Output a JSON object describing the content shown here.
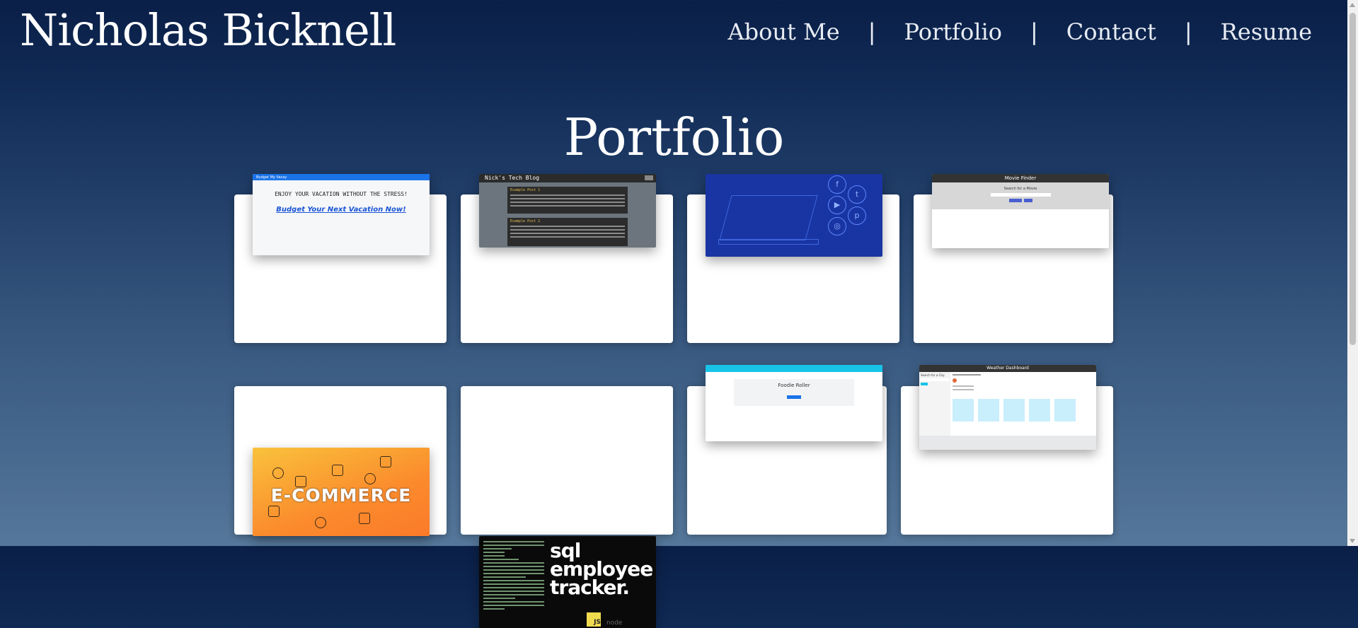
{
  "header": {
    "site_title": "Nicholas Bicknell",
    "nav": [
      {
        "label": "About Me"
      },
      {
        "label": "Portfolio"
      },
      {
        "label": "Contact"
      },
      {
        "label": "Resume"
      }
    ],
    "separator": "|"
  },
  "main": {
    "heading": "Portfolio",
    "projects": [
      {
        "id": "budget",
        "lines": [
          "Budget My Vacay",
          "ENJOY YOUR VACATION WITHOUT THE STRESS!",
          "Budget Your Next Vacation Now!"
        ]
      },
      {
        "id": "blog",
        "lines": [
          "Nick's Tech Blog",
          "Example Post 1",
          "Example Post 2"
        ]
      },
      {
        "id": "social",
        "lines": []
      },
      {
        "id": "movie",
        "lines": [
          "Movie Finder",
          "Search for a Movie"
        ]
      },
      {
        "id": "ecommerce",
        "lines": [
          "E-COMMERCE"
        ]
      },
      {
        "id": "sql",
        "lines": [
          "sql",
          "employee",
          "tracker."
        ]
      },
      {
        "id": "foodie",
        "lines": [
          "Foodie Roller"
        ]
      },
      {
        "id": "weather",
        "lines": [
          "Weather Dashboard",
          "Search for a City:"
        ]
      }
    ]
  },
  "icons": {
    "social": [
      "facebook-icon",
      "twitter-icon",
      "youtube-icon",
      "pinterest-icon",
      "instagram-icon"
    ]
  },
  "colors": {
    "background_top": "#0a1f47",
    "background_bottom": "#55779a",
    "card": "#ffffff"
  }
}
